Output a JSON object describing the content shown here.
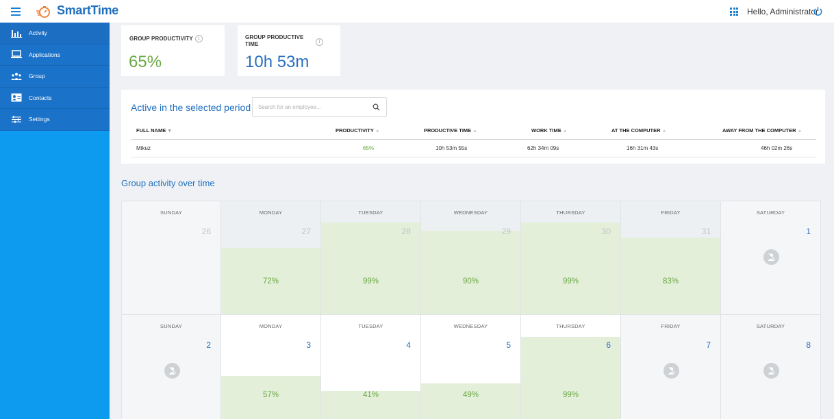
{
  "app": {
    "name": "SmartTime",
    "greeting": "Hello, Administrator"
  },
  "colors": {
    "brand": "#1f6fbf",
    "sidebar": "#0d9bf0",
    "sidebar_menu": "#1a72c9",
    "productive": "#6aa843",
    "productive_fill": "#e3efd9"
  },
  "sidebar": {
    "items": [
      {
        "label": "Activity",
        "icon": "bar-chart-icon"
      },
      {
        "label": "Applications",
        "icon": "laptop-icon"
      },
      {
        "label": "Group",
        "icon": "group-icon"
      },
      {
        "label": "Contacts",
        "icon": "contact-card-icon"
      },
      {
        "label": "Settings",
        "icon": "sliders-icon"
      }
    ]
  },
  "stats": {
    "productivity": {
      "title": "GROUP PRODUCTIVITY",
      "value": "65%"
    },
    "productive_time": {
      "title_line1": "GROUP PRODUCTIVE",
      "title_line2": "TIME",
      "value": "10h 53m"
    }
  },
  "employees": {
    "title": "Active in the selected period",
    "search_placeholder": "Search for an employee...",
    "columns": [
      "FULL NAME",
      "PRODUCTIVITY",
      "PRODUCTIVE TIME",
      "WORK TIME",
      "AT THE COMPUTER",
      "AWAY FROM THE COMPUTER"
    ],
    "rows": [
      {
        "name": "Mikuz",
        "productivity": "65%",
        "productive_time": "10h 53m 55s",
        "work_time": "62h 34m 09s",
        "at_computer": "16h 31m 43s",
        "away": "46h 02m 26s"
      }
    ]
  },
  "group_activity": {
    "title": "Group activity over time",
    "weeks": [
      [
        {
          "day": "SUNDAY",
          "date": "26",
          "in_month": false,
          "pct": null,
          "pct_value": 0,
          "away": false
        },
        {
          "day": "MONDAY",
          "date": "27",
          "in_month": false,
          "pct": "72%",
          "pct_value": 0.72,
          "away": false
        },
        {
          "day": "TUESDAY",
          "date": "28",
          "in_month": false,
          "pct": "99%",
          "pct_value": 0.99,
          "away": false
        },
        {
          "day": "WEDNESDAY",
          "date": "29",
          "in_month": false,
          "pct": "90%",
          "pct_value": 0.9,
          "away": false
        },
        {
          "day": "THURSDAY",
          "date": "30",
          "in_month": false,
          "pct": "99%",
          "pct_value": 0.99,
          "away": false
        },
        {
          "day": "FRIDAY",
          "date": "31",
          "in_month": false,
          "pct": "83%",
          "pct_value": 0.83,
          "away": false
        },
        {
          "day": "SATURDAY",
          "date": "1",
          "in_month": true,
          "pct": null,
          "pct_value": 0,
          "away": true
        }
      ],
      [
        {
          "day": "SUNDAY",
          "date": "2",
          "in_month": true,
          "pct": null,
          "pct_value": 0,
          "away": true
        },
        {
          "day": "MONDAY",
          "date": "3",
          "in_month": true,
          "pct": "57%",
          "pct_value": 0.57,
          "away": false
        },
        {
          "day": "TUESDAY",
          "date": "4",
          "in_month": true,
          "pct": "41%",
          "pct_value": 0.41,
          "away": false
        },
        {
          "day": "WEDNESDAY",
          "date": "5",
          "in_month": true,
          "pct": "49%",
          "pct_value": 0.49,
          "away": false
        },
        {
          "day": "THURSDAY",
          "date": "6",
          "in_month": true,
          "pct": "99%",
          "pct_value": 0.99,
          "away": false
        },
        {
          "day": "FRIDAY",
          "date": "7",
          "in_month": true,
          "pct": null,
          "pct_value": 0,
          "away": true
        },
        {
          "day": "SATURDAY",
          "date": "8",
          "in_month": true,
          "pct": null,
          "pct_value": 0,
          "away": true
        }
      ]
    ]
  }
}
